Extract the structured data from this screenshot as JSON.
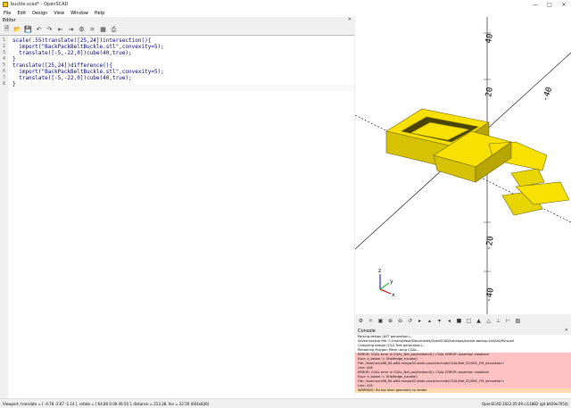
{
  "window": {
    "title": "buckle.scad* - OpenSCAD"
  },
  "menu": [
    "File",
    "Edit",
    "Design",
    "View",
    "Window",
    "Help"
  ],
  "editor": {
    "label": "Editor",
    "lines": [
      {
        "n": "1",
        "text": "scale(.55)translate([25,24])intersection(){"
      },
      {
        "n": "2",
        "text": "  import(\"BackPackBeltBuckle.stl\",convexity=5);"
      },
      {
        "n": "3",
        "text": "  translate([-5,-22,0])cube(40,true);"
      },
      {
        "n": "4",
        "text": "}"
      },
      {
        "n": "5",
        "text": "translate([25,24])difference(){"
      },
      {
        "n": "6",
        "text": "  import(\"BackPackBeltBuckle.stl\",convexity=5);"
      },
      {
        "n": "7",
        "text": "  translate([-5,-22,0])cube(40,true);"
      },
      {
        "n": "8",
        "text": "}"
      }
    ]
  },
  "viewport": {
    "axis_labels": [
      "40",
      "20",
      "20",
      "-20",
      "-40",
      "-40"
    ],
    "axis_gizmo": [
      "z",
      "x",
      "y"
    ]
  },
  "console": {
    "label": "Console",
    "lines": [
      {
        "t": "Parsing design (AST generation)...",
        "k": "info"
      },
      {
        "t": "Saved backup file: C:/Users/Jesse/Documents/OpenSCAD/backups/buckle-backup-UoQUArRV.scad",
        "k": "info"
      },
      {
        "t": "Compiling design (CSG Tree generation)...",
        "k": "info"
      },
      {
        "t": "Rendering Polygon Mesh using CGAL...",
        "k": "info"
      },
      {
        "t": "ERROR: CGAL error in CGAL_Nef_polyhedron3(): CGAL ERROR: assertion violation!",
        "k": "error"
      },
      {
        "t": "Expr: e_below != SHalfedge_handle()",
        "k": "error"
      },
      {
        "t": "File: /mxe/usr/x86_64-w64-mingw32.static.posix/include/CGAL/Nef_S2/SNC_FM_decorator.h",
        "k": "error"
      },
      {
        "t": "Line: 418",
        "k": "error"
      },
      {
        "t": "ERROR: CGAL error in CGAL_Nef_polyhedron3(): CGAL ERROR: assertion violation!",
        "k": "error"
      },
      {
        "t": "Expr: e_below != SHalfedge_handle()",
        "k": "error"
      },
      {
        "t": "File: /mxe/usr/x86_64-w64-mingw32.static.posix/include/CGAL/Nef_S2/SNC_FM_decorator.h",
        "k": "error"
      },
      {
        "t": "Line: 418",
        "k": "error"
      },
      {
        "t": "WARNING: No top level geometry to render",
        "k": "warn"
      }
    ]
  },
  "status": {
    "left": "Viewport: translate = [ -4.78 -2.67 -1.14 ], rotate = [ 64.80 0.00 49.50 ], distance = 213.38, fov = 22.50 (604x836)",
    "right": "OpenSCAD 2022.05.09.ci11882 (git b929e7054)"
  },
  "colors": {
    "model": "#f8e100",
    "model_shade": "#b8a600",
    "edge": "#6f6600"
  }
}
